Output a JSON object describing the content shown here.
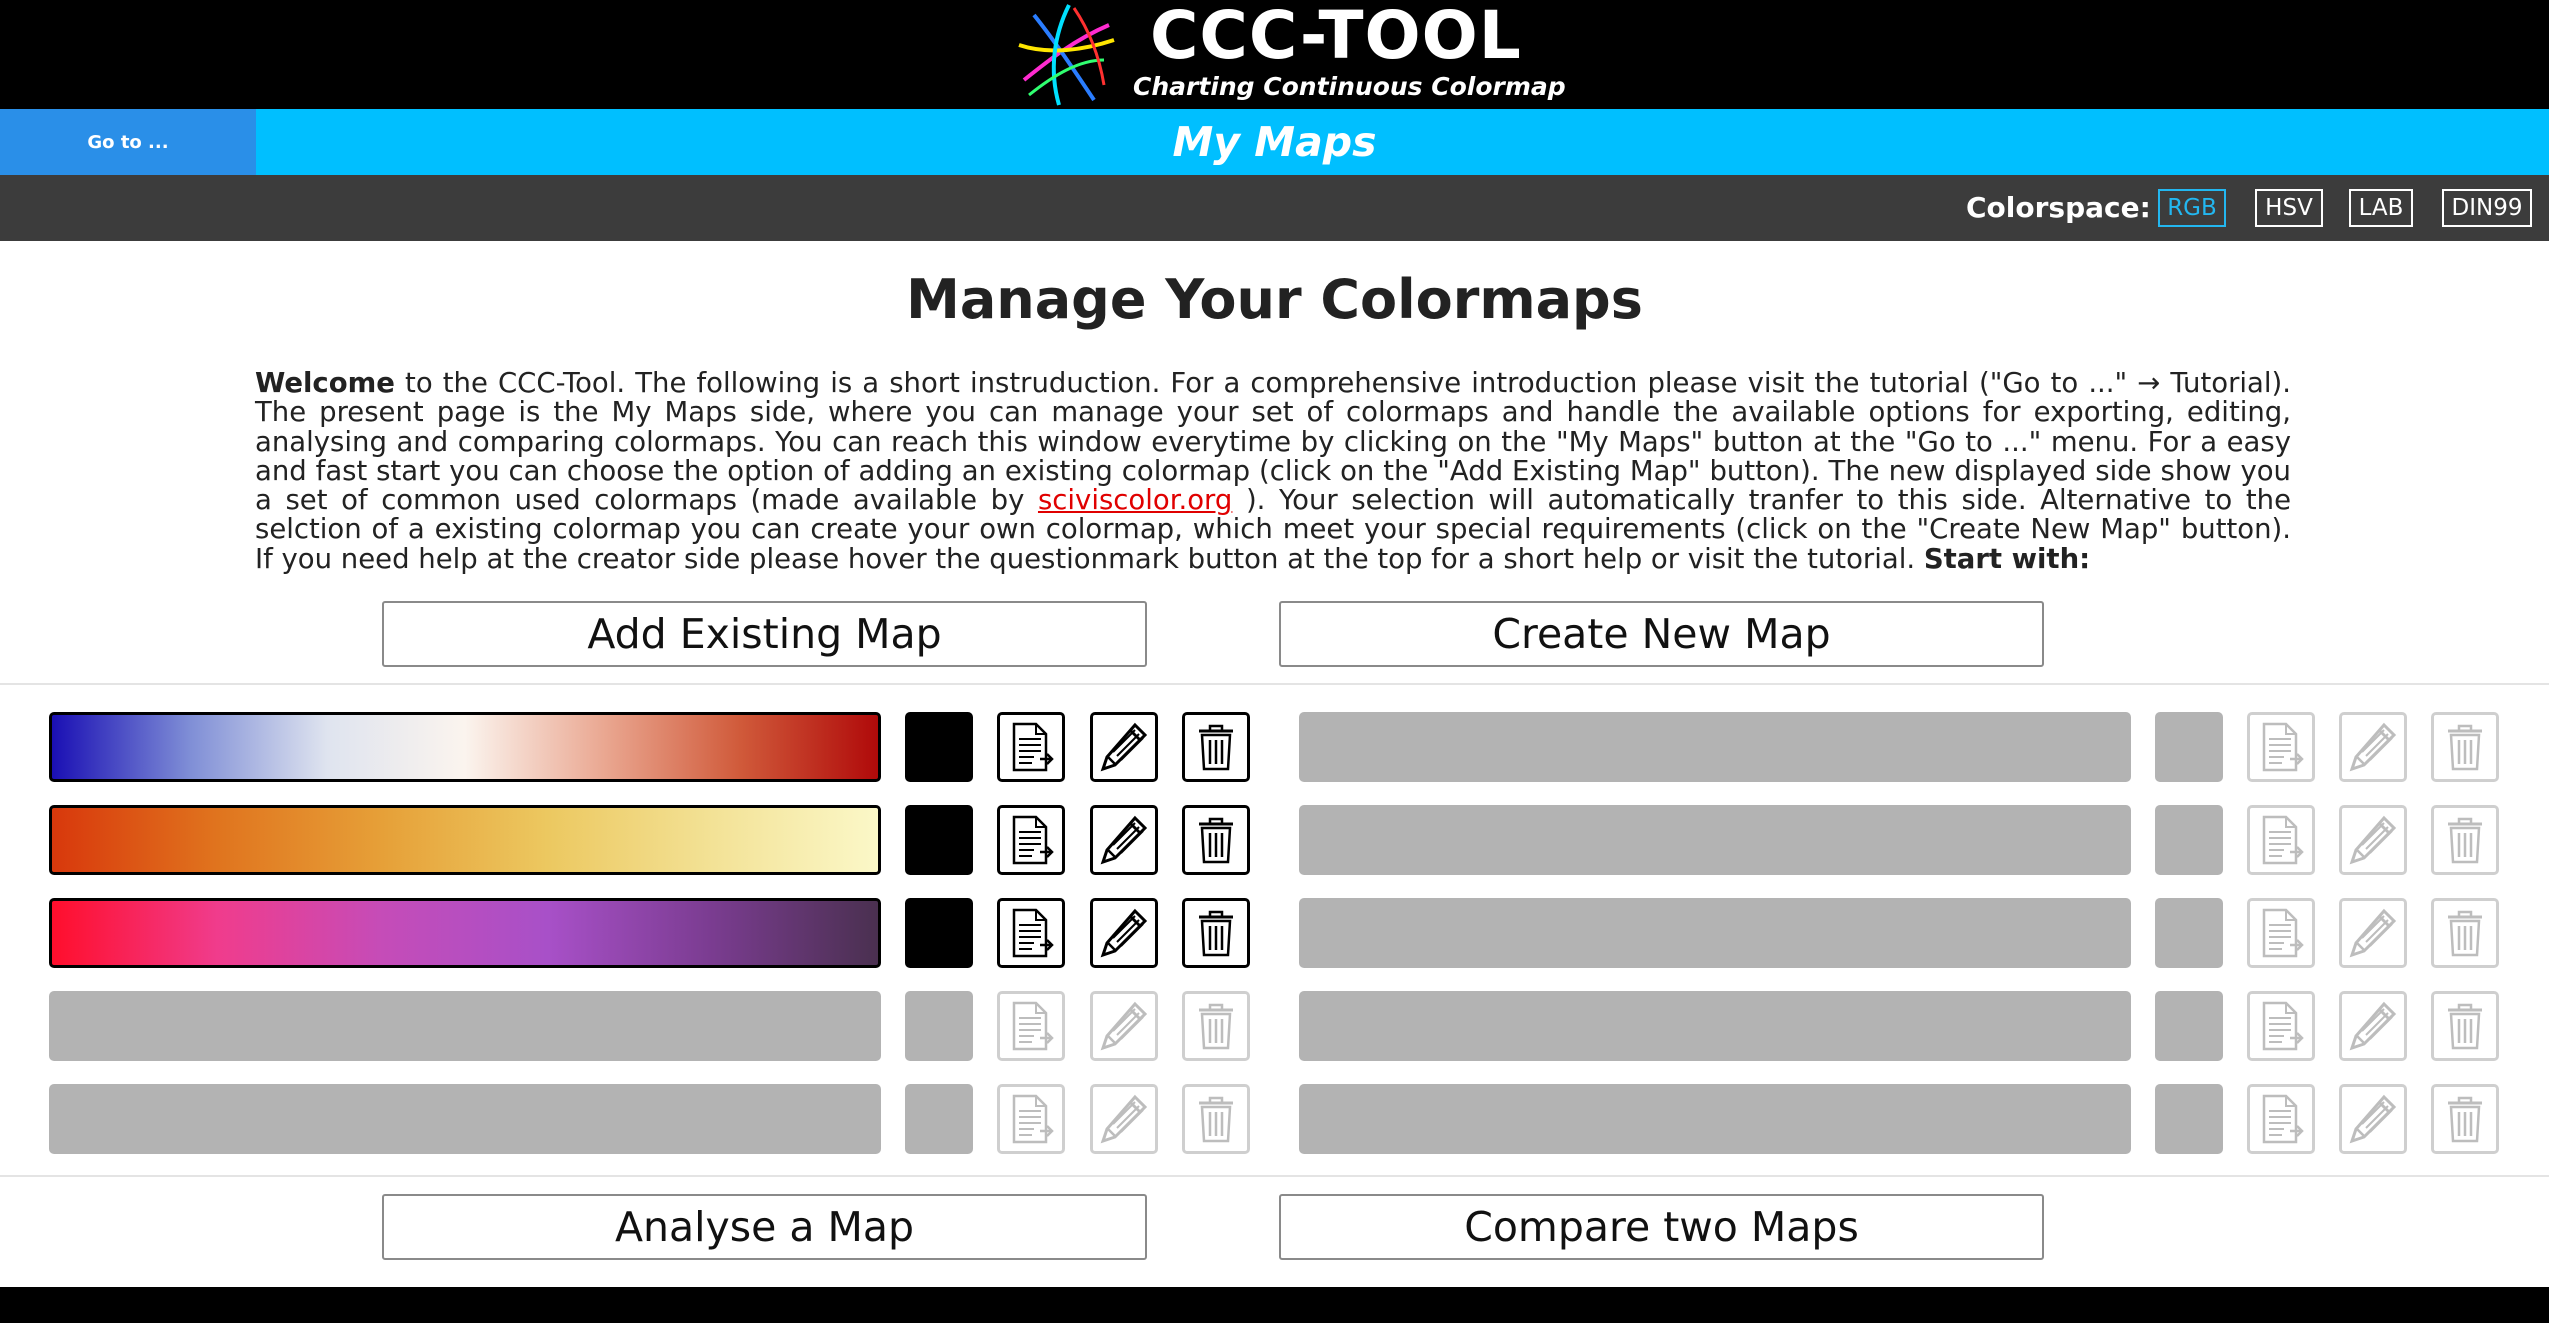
{
  "header": {
    "title": "CCC-TOOL",
    "subtitle": "Charting Continuous Colormap",
    "logo_icon": "ccc-tool-logo-icon"
  },
  "navbar": {
    "goto_label": "Go to ...",
    "page_title": "My Maps",
    "accent_color": "#00bfff"
  },
  "colorspace": {
    "label": "Colorspace:",
    "options": [
      "RGB",
      "HSV",
      "LAB",
      "DIN99"
    ],
    "selected": "RGB"
  },
  "main": {
    "heading": "Manage Your Colormaps",
    "intro": {
      "welcome": "Welcome",
      "part1": " to the CCC-Tool. The following is a short instruduction. For a comprehensive introduction please visit the tutorial (\"Go to ...\" → Tutorial). The present page is the My Maps side, where you can manage your set of colormaps and handle the available options for exporting, editing, analysing and comparing colormaps. You can reach this window everytime by clicking on the \"My Maps\" button at the \"Go to ...\" menu. For a easy and fast start you can choose the option of adding an existing colormap (click on the \"Add Existing Map\" button). The new displayed side show you a set of common used colormaps (made available by ",
      "link": "sciviscolor.org",
      "part2": " ). Your selection will automatically tranfer to this side. Alternative to the selction of a existing colormap you can create your own colormap, which meet your special requirements (click on the \"Create New Map\" button). If you need help at the creator side please hover the questionmark button at the top for a short help or visit the tutorial. ",
      "start": "Start with:"
    },
    "add_existing_label": "Add Existing Map",
    "create_new_label": "Create New Map",
    "analyse_label": "Analyse a Map",
    "compare_label": "Compare two Maps"
  },
  "slots": {
    "left": [
      {
        "filled": true,
        "gradient": [
          "#1a0fb4",
          "#7f8ed6",
          "#dfe4ef",
          "#fbf4ee",
          "#eaa892",
          "#d05a3a",
          "#b00a0a"
        ]
      },
      {
        "filled": true,
        "gradient": [
          "#d8380c",
          "#e0741e",
          "#e6a038",
          "#ecc860",
          "#f3e296",
          "#fbf8c8"
        ]
      },
      {
        "filled": true,
        "gradient": [
          "#ff0e2c",
          "#f03c8c",
          "#c54cb8",
          "#a850c8",
          "#7a3c90",
          "#4a3050"
        ]
      },
      {
        "filled": false
      },
      {
        "filled": false
      }
    ],
    "right": [
      {
        "filled": false
      },
      {
        "filled": false
      },
      {
        "filled": false
      },
      {
        "filled": false
      },
      {
        "filled": false
      }
    ],
    "icon_names": [
      "export-document-icon",
      "edit-pencil-icon",
      "delete-trash-icon"
    ]
  }
}
